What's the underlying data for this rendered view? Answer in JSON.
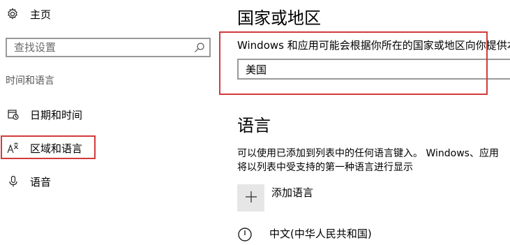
{
  "sidebar": {
    "home_label": "主页",
    "search": {
      "placeholder": "查找设置"
    },
    "group_title": "时间和语言",
    "items": [
      {
        "label": "日期和时间",
        "icon": "calendar-clock-icon"
      },
      {
        "label": "区域和语言",
        "icon": "language-icon"
      },
      {
        "label": "语音",
        "icon": "microphone-icon"
      }
    ]
  },
  "main": {
    "region": {
      "title": "国家或地区",
      "description": "Windows 和应用可能会根据你所在的国家或地区向你提供本",
      "selected": "美国"
    },
    "language": {
      "title": "语言",
      "description_line1": "可以使用已添加到列表中的任何语言键入。 Windows、应用",
      "description_line2": "将以列表中受支持的第一种语言进行显示",
      "add_label": "添加语言",
      "items": [
        {
          "label": "中文(中华人民共和国)"
        }
      ]
    }
  },
  "colors": {
    "highlight": "#d33a3a",
    "border": "#999999",
    "tile": "#e6e6e6"
  }
}
